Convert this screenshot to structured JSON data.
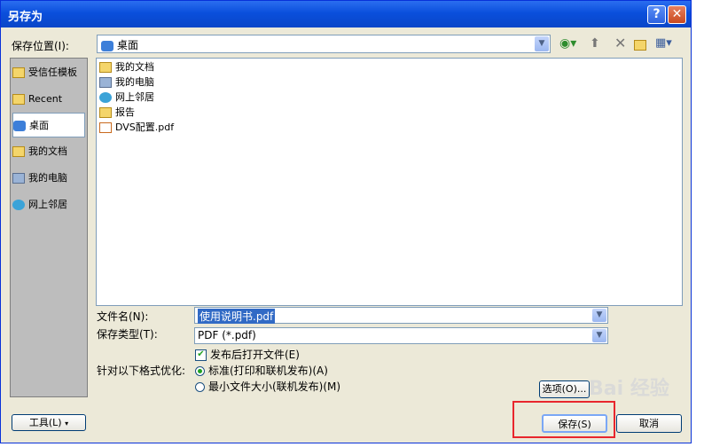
{
  "window": {
    "title": "另存为",
    "help": "?",
    "close": "✕"
  },
  "location": {
    "label": "保存位置(I):",
    "value": "桌面"
  },
  "places": [
    {
      "label": "受信任模板",
      "icon": "folder-icon"
    },
    {
      "label": "Recent",
      "icon": "folder-icon"
    },
    {
      "label": "桌面",
      "icon": "desktop-icon"
    },
    {
      "label": "我的文档",
      "icon": "folder-icon"
    },
    {
      "label": "我的电脑",
      "icon": "computer-icon"
    },
    {
      "label": "网上邻居",
      "icon": "network-icon"
    }
  ],
  "files": [
    {
      "name": "我的文档",
      "icon": "folder-icon"
    },
    {
      "name": "我的电脑",
      "icon": "computer-icon"
    },
    {
      "name": "网上邻居",
      "icon": "network-icon"
    },
    {
      "name": "报告",
      "icon": "folder-icon"
    },
    {
      "name": "DVS配置.pdf",
      "icon": "pdf-file-icon"
    }
  ],
  "filename": {
    "label": "文件名(N):",
    "value": "使用说明书.pdf"
  },
  "filetype": {
    "label": "保存类型(T):",
    "value": "PDF (*.pdf)"
  },
  "open_after": {
    "label": "发布后打开文件(E)",
    "checked": true
  },
  "optimize": {
    "label": "针对以下格式优化:",
    "options": [
      {
        "label": "标准(打印和联机发布)(A)",
        "selected": true
      },
      {
        "label": "最小文件大小(联机发布)(M)",
        "selected": false
      }
    ]
  },
  "buttons": {
    "options": "选项(O)...",
    "tools": "工具(L)",
    "save": "保存(S)",
    "cancel": "取消"
  },
  "watermark": "Bai 经验"
}
